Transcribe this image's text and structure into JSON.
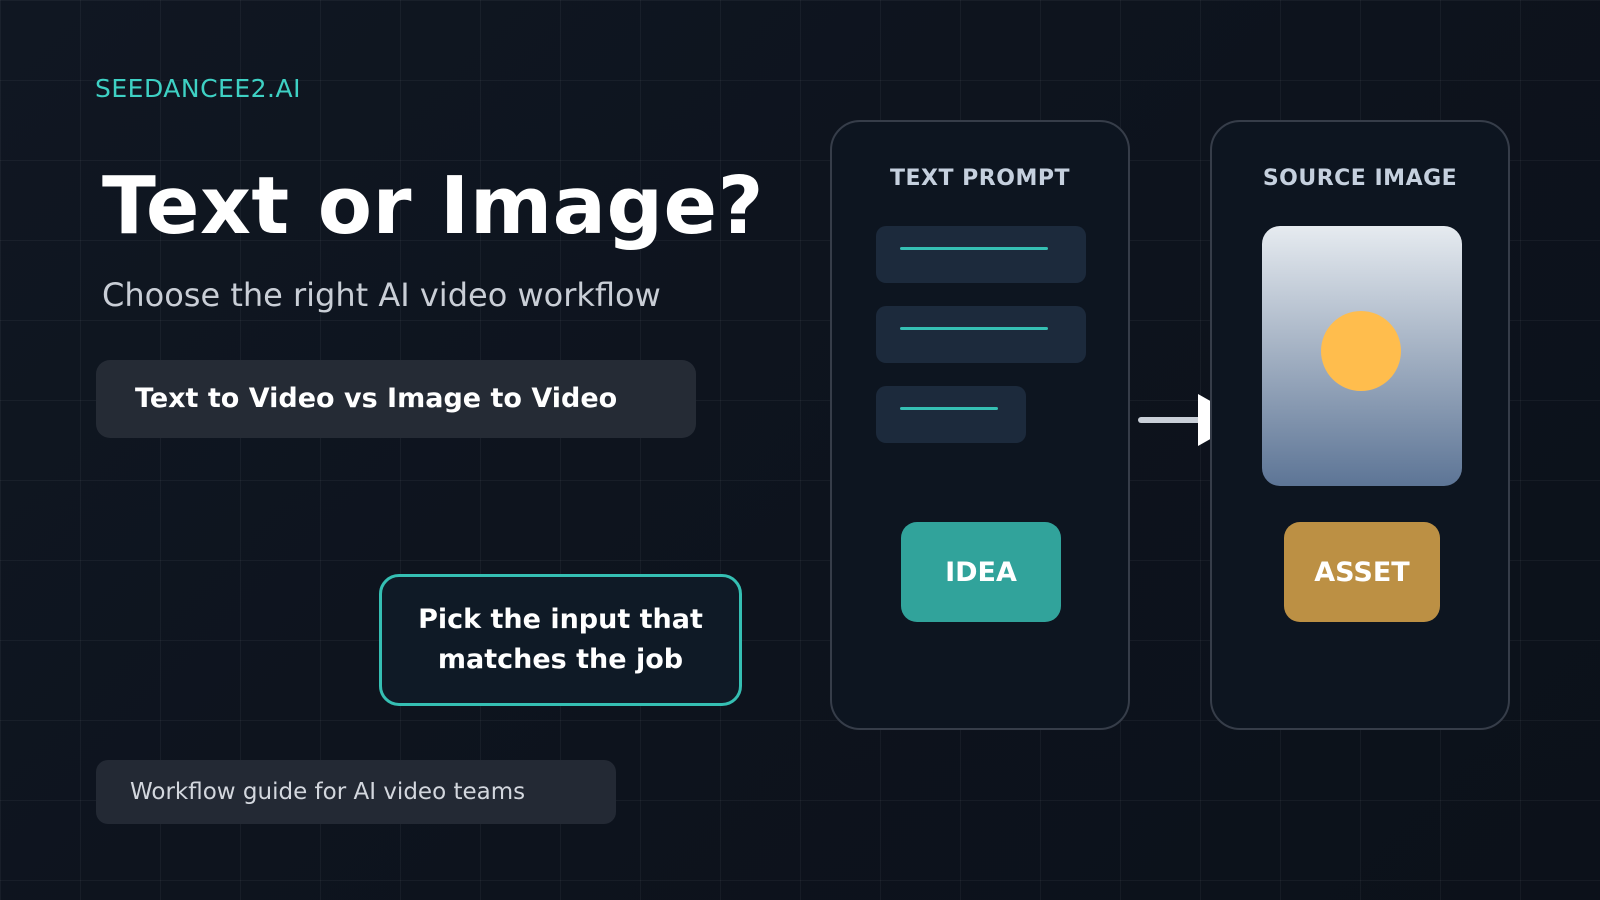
{
  "brand": "SEEDANCEE2.AI",
  "headline": "Text or Image?",
  "subheadline": "Choose the right AI video workflow",
  "comparison_label": "Text to Video vs Image to Video",
  "callout": {
    "line1": "Pick the input that",
    "line2": "matches the job"
  },
  "footer_label": "Workflow guide for AI video teams",
  "cards": {
    "left": {
      "title": "TEXT PROMPT",
      "tag": "IDEA"
    },
    "right": {
      "title": "SOURCE IMAGE",
      "tag": "ASSET"
    }
  },
  "icons": {
    "flow": "arrow-right-icon",
    "image_subject": "sun-icon"
  },
  "colors": {
    "accent_teal": "#35bfb3",
    "idea_tag": "#31a39b",
    "asset_tag": "#bc9044",
    "sun": "#ffbd4d",
    "background": "#0e141e"
  }
}
